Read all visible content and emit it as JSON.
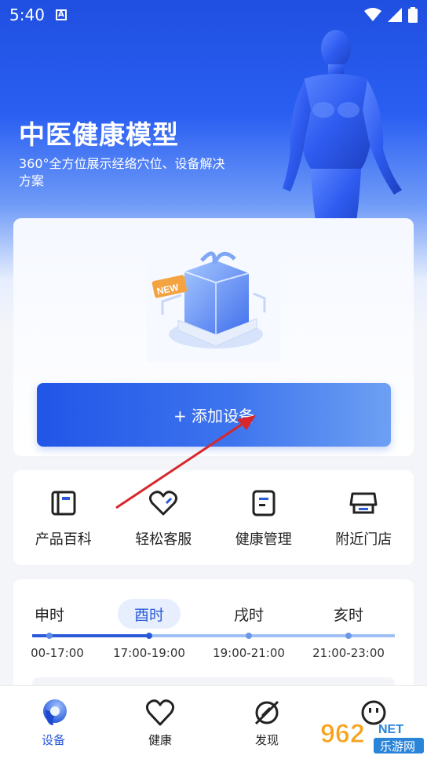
{
  "status_bar": {
    "time": "5:40",
    "a_badge": "A"
  },
  "hero": {
    "title": "中医健康模型",
    "subtitle": "360°全方位展示经络穴位、设备解决方案"
  },
  "device_card": {
    "new_badge": "NEW",
    "add_button": "+ 添加设备"
  },
  "quick_actions": [
    {
      "label": "产品百科",
      "icon": "book-icon"
    },
    {
      "label": "轻松客服",
      "icon": "heart-icon"
    },
    {
      "label": "健康管理",
      "icon": "document-icon"
    },
    {
      "label": "附近门店",
      "icon": "store-icon"
    }
  ],
  "time_periods": {
    "tabs": [
      "申时",
      "酉时",
      "戌时",
      "亥时"
    ],
    "active_index": 1,
    "ranges": [
      "00-17:00",
      "17:00-19:00",
      "19:00-21:00",
      "21:00-23:00"
    ]
  },
  "tab_bar": [
    {
      "label": "设备",
      "icon": "device-icon",
      "active": true
    },
    {
      "label": "健康",
      "icon": "heart-outline-icon",
      "active": false
    },
    {
      "label": "发现",
      "icon": "compass-icon",
      "active": false
    },
    {
      "label": "",
      "icon": "smiley-icon",
      "active": false
    }
  ],
  "watermark": {
    "brand": "962",
    "suffix": "NET",
    "text": "乐游网"
  },
  "colors": {
    "primary": "#2a5ad8",
    "hero_top": "#1f4fe0",
    "tab_active_bg": "#e7eefe",
    "annotation": "#d8262c"
  }
}
